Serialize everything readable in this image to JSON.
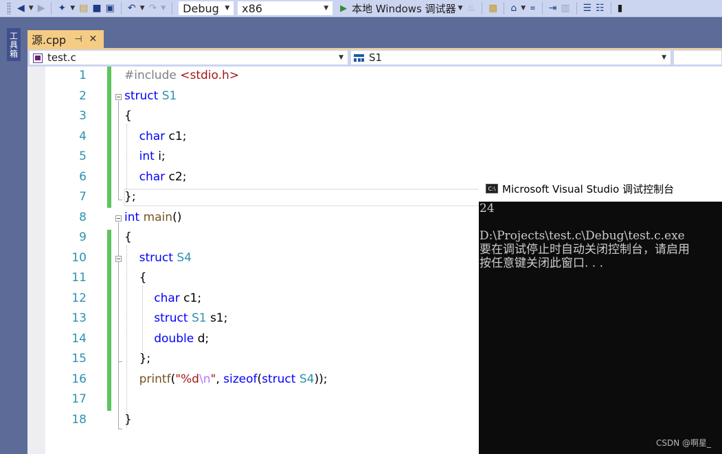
{
  "toolbar": {
    "config": "Debug",
    "platform": "x86",
    "run_label": "本地 Windows 调试器"
  },
  "toolbox": {
    "label": "工具箱"
  },
  "doc_tab": {
    "title": "源.cpp",
    "pin": "⊣",
    "close": "✕"
  },
  "navbar": {
    "file": "test.c",
    "member": "S1"
  },
  "editor": {
    "line_numbers": [
      "1",
      "2",
      "3",
      "4",
      "5",
      "6",
      "7",
      "8",
      "9",
      "10",
      "11",
      "12",
      "13",
      "14",
      "15",
      "16",
      "17",
      "18"
    ],
    "lines": [
      [
        {
          "t": "#include ",
          "c": "pp"
        },
        {
          "t": "<stdio.h>",
          "c": "str"
        }
      ],
      [
        {
          "t": "struct ",
          "c": "kw"
        },
        {
          "t": "S1",
          "c": "ty"
        }
      ],
      [
        {
          "t": "{",
          "c": ""
        }
      ],
      [
        {
          "t": "    ",
          "c": ""
        },
        {
          "t": "char",
          "c": "kw"
        },
        {
          "t": " c1;",
          "c": ""
        }
      ],
      [
        {
          "t": "    ",
          "c": ""
        },
        {
          "t": "int",
          "c": "kw"
        },
        {
          "t": " i;",
          "c": ""
        }
      ],
      [
        {
          "t": "    ",
          "c": ""
        },
        {
          "t": "char",
          "c": "kw"
        },
        {
          "t": " c2;",
          "c": ""
        }
      ],
      [
        {
          "t": "};",
          "c": ""
        }
      ],
      [
        {
          "t": "int ",
          "c": "kw"
        },
        {
          "t": "main",
          "c": "fn"
        },
        {
          "t": "()",
          "c": ""
        }
      ],
      [
        {
          "t": "{",
          "c": ""
        }
      ],
      [
        {
          "t": "    ",
          "c": ""
        },
        {
          "t": "struct ",
          "c": "kw"
        },
        {
          "t": "S4",
          "c": "ty"
        }
      ],
      [
        {
          "t": "    {",
          "c": ""
        }
      ],
      [
        {
          "t": "        ",
          "c": ""
        },
        {
          "t": "char",
          "c": "kw"
        },
        {
          "t": " c1;",
          "c": ""
        }
      ],
      [
        {
          "t": "        ",
          "c": ""
        },
        {
          "t": "struct ",
          "c": "kw"
        },
        {
          "t": "S1",
          "c": "ty"
        },
        {
          "t": " s1;",
          "c": ""
        }
      ],
      [
        {
          "t": "        ",
          "c": ""
        },
        {
          "t": "double",
          "c": "kw"
        },
        {
          "t": " d;",
          "c": ""
        }
      ],
      [
        {
          "t": "    };",
          "c": ""
        }
      ],
      [
        {
          "t": "    ",
          "c": ""
        },
        {
          "t": "printf",
          "c": "fn"
        },
        {
          "t": "(",
          "c": ""
        },
        {
          "t": "\"%d",
          "c": "str"
        },
        {
          "t": "\\n",
          "c": "esc"
        },
        {
          "t": "\"",
          "c": "str"
        },
        {
          "t": ", ",
          "c": ""
        },
        {
          "t": "sizeof",
          "c": "kw"
        },
        {
          "t": "(",
          "c": ""
        },
        {
          "t": "struct ",
          "c": "kw"
        },
        {
          "t": "S4",
          "c": "ty"
        },
        {
          "t": "));",
          "c": ""
        }
      ],
      [
        {
          "t": "",
          "c": ""
        }
      ],
      [
        {
          "t": "}",
          "c": ""
        }
      ]
    ]
  },
  "console": {
    "title": "Microsoft Visual Studio 调试控制台",
    "icon_text": "C:\\",
    "output_lines": [
      "24",
      "",
      "D:\\Projects\\test.c\\Debug\\test.c.exe",
      "要在调试停止时自动关闭控制台，请启用",
      "按任意键关闭此窗口. . ."
    ]
  },
  "watermark": "CSDN @啊星_",
  "colors": {
    "keyword": "#0000ff",
    "type": "#2b91af",
    "string": "#a31515",
    "line_number": "#2b91af",
    "change_bar": "#5ec45e",
    "tab_active": "#f5cc84",
    "chrome": "#5d6b99"
  }
}
